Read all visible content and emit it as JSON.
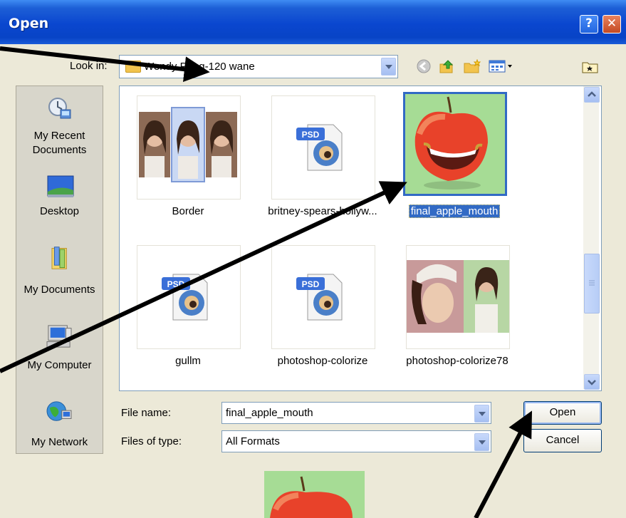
{
  "window": {
    "title": "Open",
    "help_glyph": "?",
    "close_glyph": "✕"
  },
  "lookin": {
    "label": "Look in:",
    "value": "Wendy Peng-120 wane"
  },
  "places": [
    {
      "line1": "My Recent",
      "line2": "Documents",
      "icon": "recent-documents-icon"
    },
    {
      "line1": "Desktop",
      "line2": "",
      "icon": "desktop-icon"
    },
    {
      "line1": "My Documents",
      "line2": "",
      "icon": "my-documents-icon"
    },
    {
      "line1": "My Computer",
      "line2": "",
      "icon": "my-computer-icon"
    },
    {
      "line1": "My Network",
      "line2": "",
      "icon": "my-network-icon"
    }
  ],
  "files": [
    {
      "name": "Border",
      "kind": "image-strip",
      "selected": false
    },
    {
      "name": "britney-spears-hollyw...",
      "kind": "psd",
      "selected": false
    },
    {
      "name": "final_apple_mouth",
      "kind": "apple",
      "selected": true
    },
    {
      "name": "gullm",
      "kind": "psd",
      "selected": false
    },
    {
      "name": "photoshop-colorize",
      "kind": "psd",
      "selected": false
    },
    {
      "name": "photoshop-colorize78",
      "kind": "photo-pair",
      "selected": false
    }
  ],
  "psd_badge": "PSD",
  "filename": {
    "label": "File name:",
    "value": "final_apple_mouth"
  },
  "filetype": {
    "label": "Files of type:",
    "value": "All Formats"
  },
  "buttons": {
    "open": "Open",
    "cancel": "Cancel"
  },
  "colors": {
    "title_bar": "#0a46cf",
    "selection": "#316ac5",
    "dialog_bg": "#ece9d8",
    "annotation_arrows": "#000000"
  }
}
